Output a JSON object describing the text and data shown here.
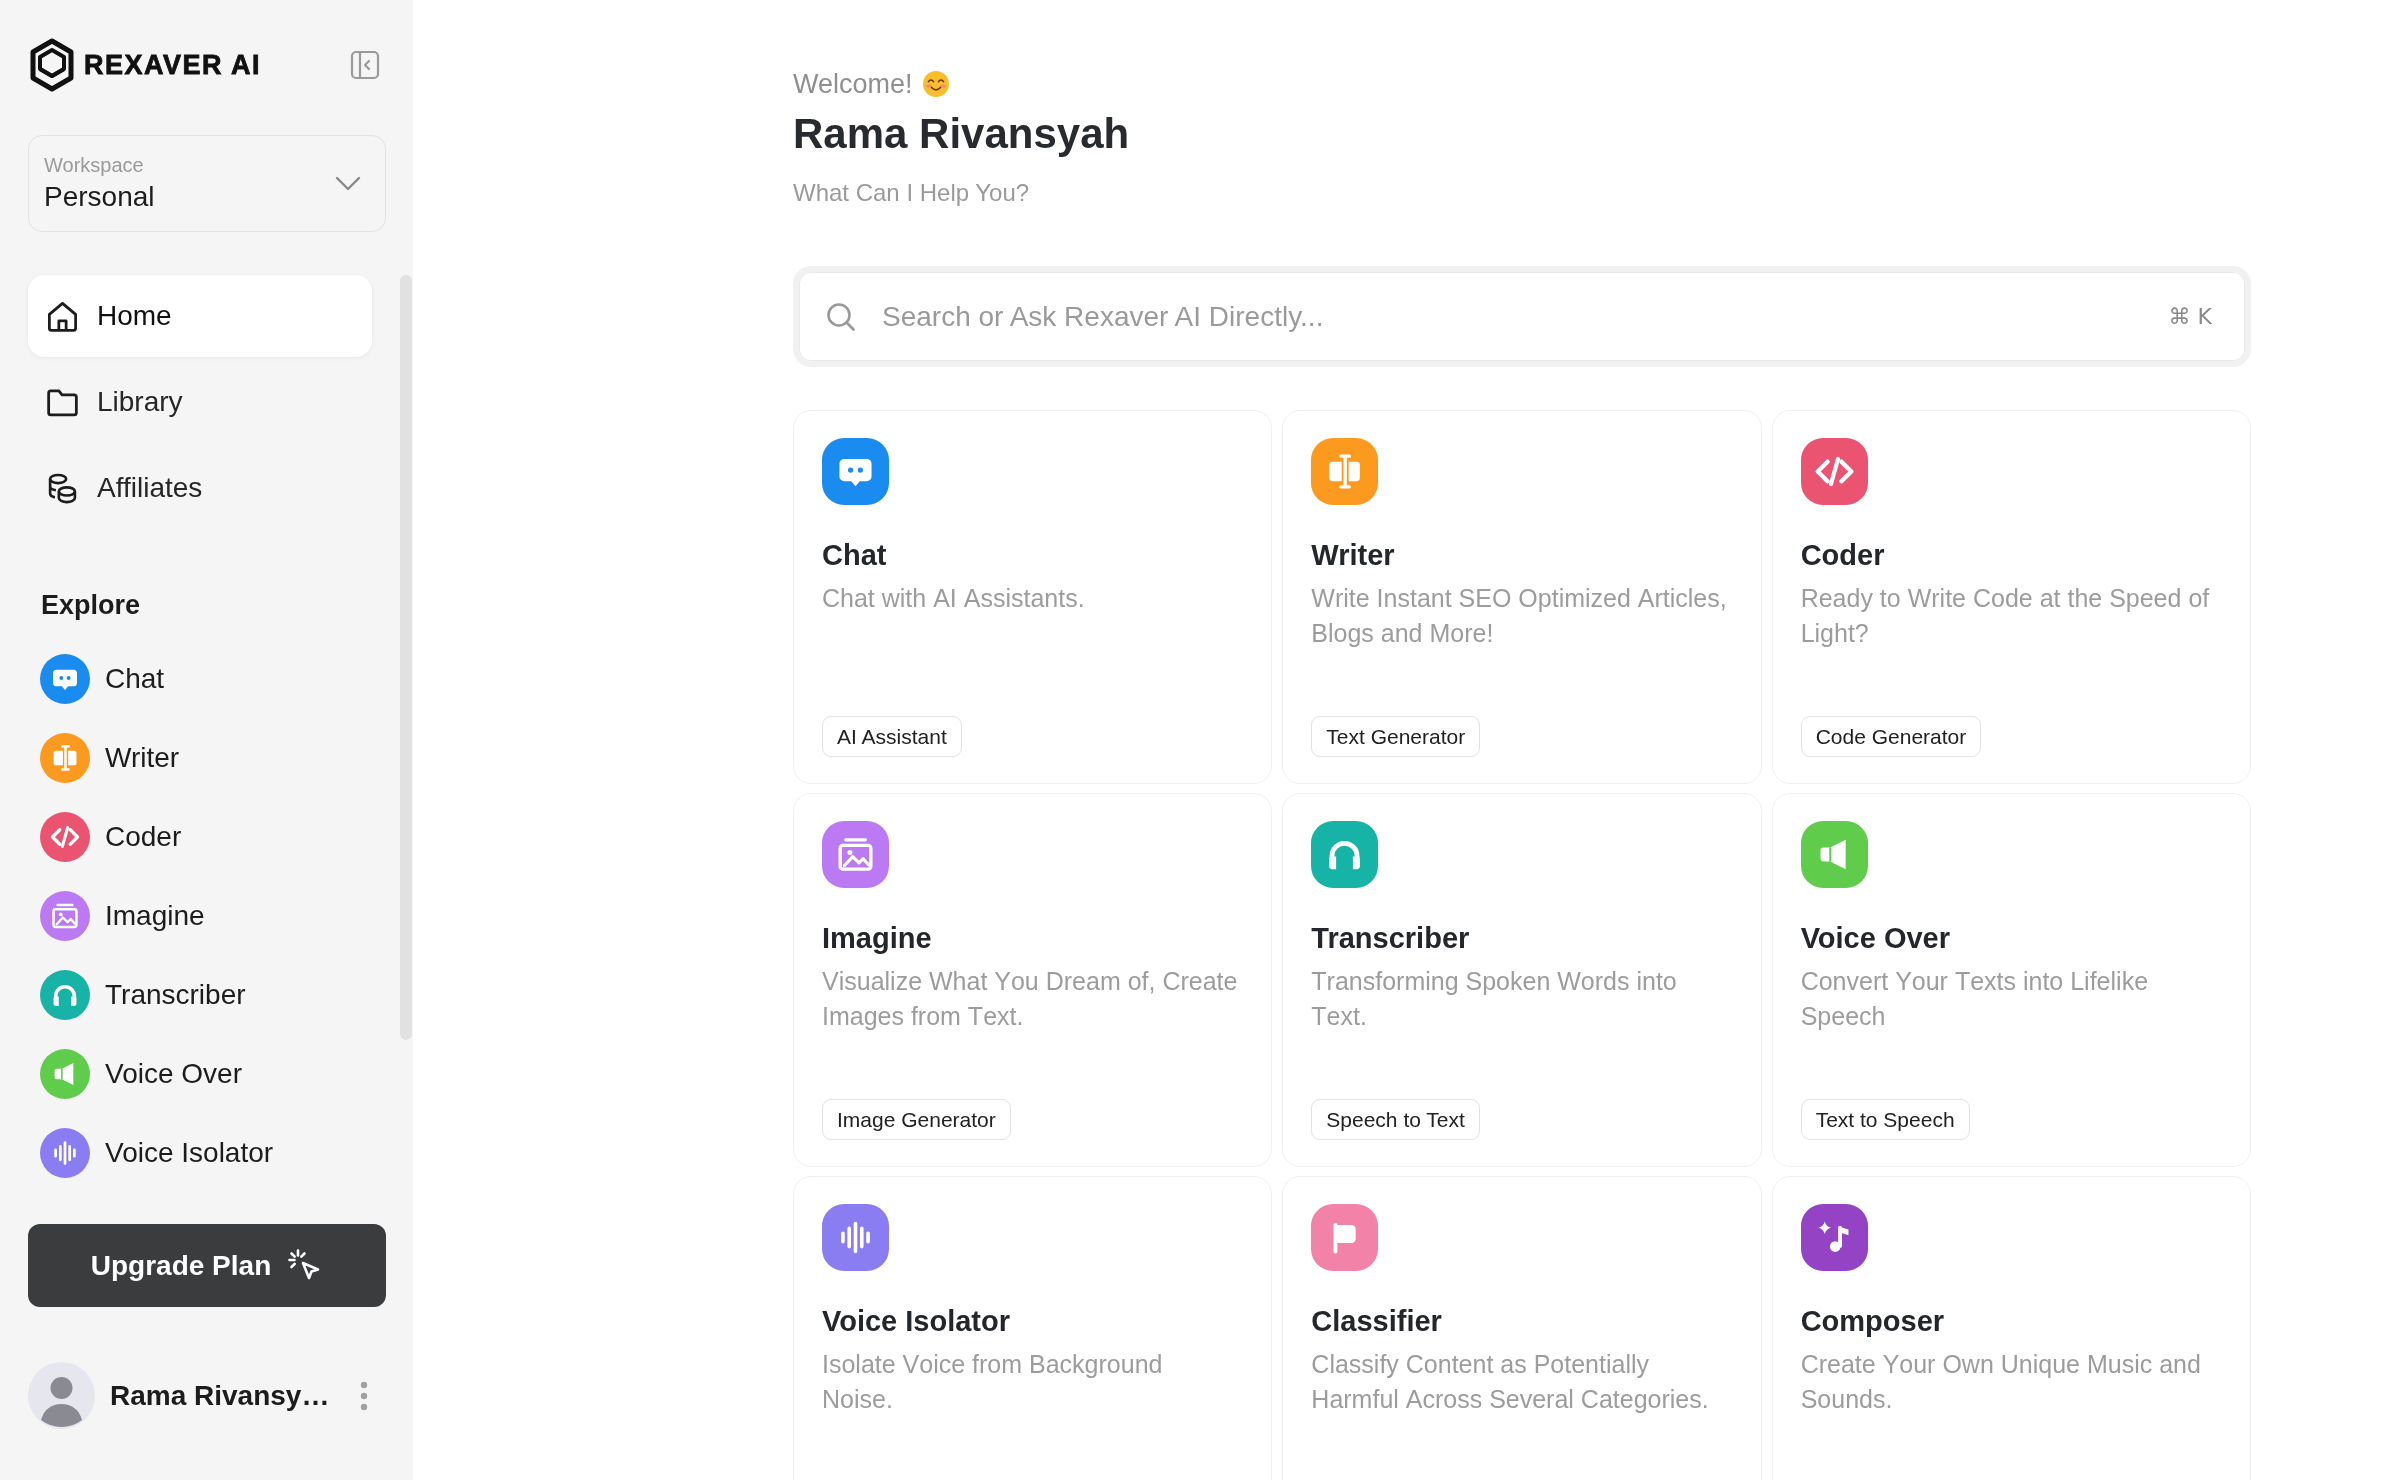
{
  "sidebar": {
    "brand": "REXAVER AI",
    "workspace": {
      "label": "Workspace",
      "value": "Personal"
    },
    "nav": [
      {
        "label": "Home",
        "kind": "home",
        "selected": true
      },
      {
        "label": "Library",
        "kind": "folder",
        "selected": false
      },
      {
        "label": "Affiliates",
        "kind": "coins",
        "selected": false
      }
    ],
    "explore": {
      "title": "Explore",
      "items": [
        {
          "label": "Chat",
          "kind": "chat",
          "color": "#1a8cf0"
        },
        {
          "label": "Writer",
          "kind": "writer",
          "color": "#fb9a1e"
        },
        {
          "label": "Coder",
          "kind": "coder",
          "color": "#ea5470"
        },
        {
          "label": "Imagine",
          "kind": "imagine",
          "color": "#bb7af3"
        },
        {
          "label": "Transcriber",
          "kind": "transcriber",
          "color": "#17b3a6"
        },
        {
          "label": "Voice Over",
          "kind": "voiceover",
          "color": "#5fcc4c"
        },
        {
          "label": "Voice Isolator",
          "kind": "isolator",
          "color": "#8a7df2"
        }
      ]
    },
    "upgrade_button": "Upgrade Plan",
    "user": {
      "name": "Rama Rivansy…"
    }
  },
  "main": {
    "greeting": "Welcome!",
    "name": "Rama Rivansyah",
    "subtitle": "What Can I Help You?",
    "search": {
      "placeholder": "Search or Ask Rexaver AI Directly...",
      "shortcut": "⌘ K"
    },
    "cards": [
      {
        "title": "Chat",
        "description": "Chat with AI Assistants.",
        "tag": "AI Assistant",
        "kind": "chat",
        "color": "#1a8cf0"
      },
      {
        "title": "Writer",
        "description": "Write Instant SEO Optimized Articles, Blogs and More!",
        "tag": "Text Generator",
        "kind": "writer",
        "color": "#fb9a1e"
      },
      {
        "title": "Coder",
        "description": "Ready to Write Code at the Speed of Light?",
        "tag": "Code Generator",
        "kind": "coder",
        "color": "#ea5470"
      },
      {
        "title": "Imagine",
        "description": "Visualize What You Dream of, Create Images from Text.",
        "tag": "Image Generator",
        "kind": "imagine",
        "color": "#bb7af3"
      },
      {
        "title": "Transcriber",
        "description": "Transforming Spoken Words into Text.",
        "tag": "Speech to Text",
        "kind": "transcriber",
        "color": "#17b3a6"
      },
      {
        "title": "Voice Over",
        "description": "Convert Your Texts into Lifelike Speech",
        "tag": "Text to Speech",
        "kind": "voiceover",
        "color": "#5fcc4c"
      },
      {
        "title": "Voice Isolator",
        "description": "Isolate Voice from Background Noise.",
        "kind": "isolator",
        "color": "#8a7df2"
      },
      {
        "title": "Classifier",
        "description": "Classify Content as Potentially Harmful Across Several Categories.",
        "kind": "classifier",
        "color": "#f282a8"
      },
      {
        "title": "Composer",
        "description": "Create Your Own Unique Music and Sounds.",
        "kind": "composer",
        "color": "#9443c4"
      }
    ]
  }
}
